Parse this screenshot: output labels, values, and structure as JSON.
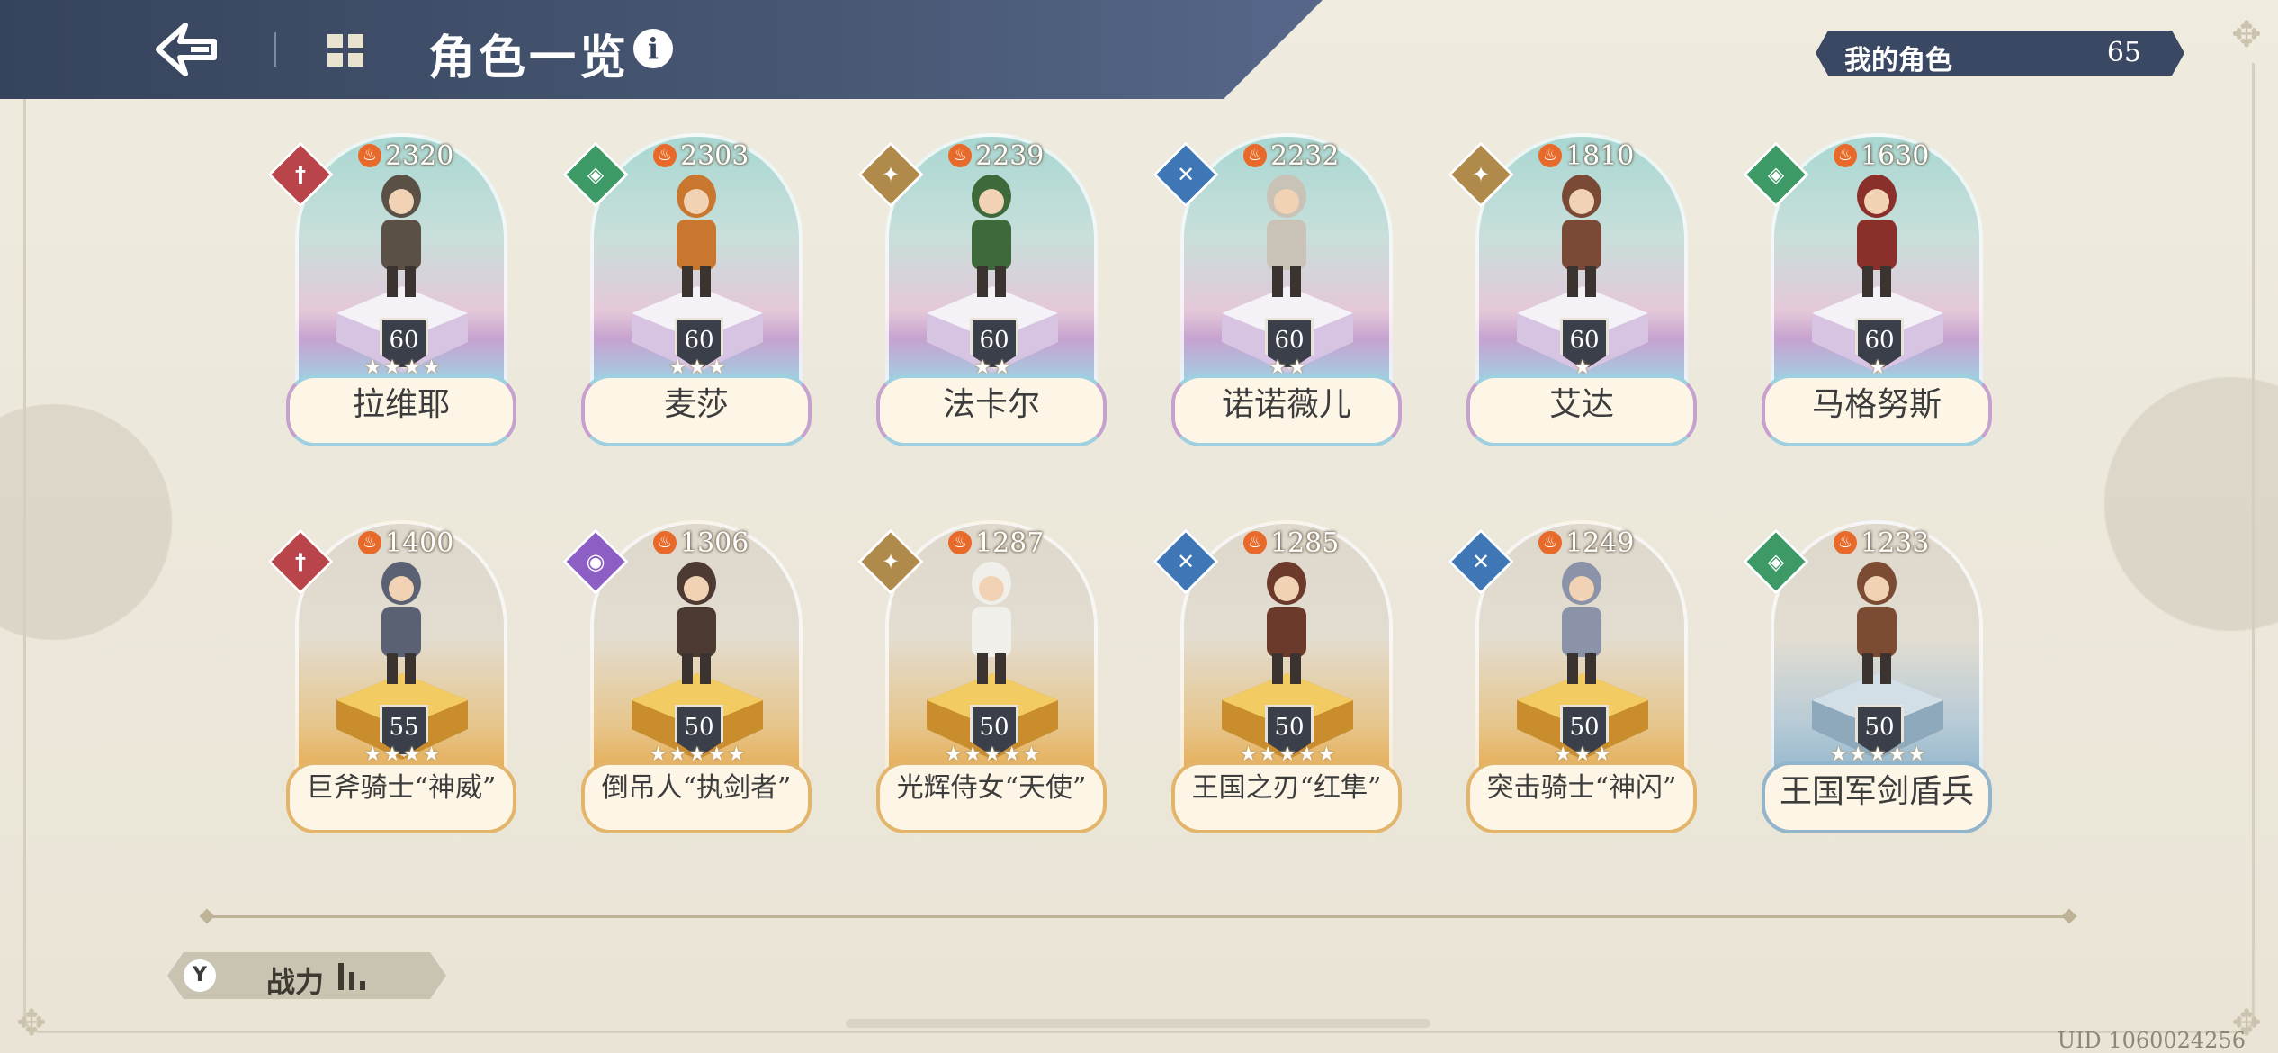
{
  "header": {
    "title": "角色一览",
    "info_glyph": "i"
  },
  "my_characters": {
    "label": "我的角色",
    "count": "65"
  },
  "colors": {
    "header_bg": "#3b4863",
    "class_red": "#b9454a",
    "class_green": "#3d9a66",
    "class_gold": "#b08a4a",
    "class_blue": "#3f77b6",
    "class_purple": "#8d5fc4"
  },
  "cards": [
    {
      "name": "拉维耶",
      "power": "2320",
      "level": "60",
      "stars": "★★★★",
      "class": "red",
      "style": "rainbow",
      "class_icon": "sword-icon"
    },
    {
      "name": "麦莎",
      "power": "2303",
      "level": "60",
      "stars": "★★★",
      "class": "green",
      "style": "rainbow",
      "class_icon": "shield-icon"
    },
    {
      "name": "法卡尔",
      "power": "2239",
      "level": "60",
      "stars": "★★",
      "class": "gold",
      "style": "rainbow",
      "class_icon": "compass-icon"
    },
    {
      "name": "诺诺薇儿",
      "power": "2232",
      "level": "60",
      "stars": "★★",
      "class": "blue",
      "style": "rainbow",
      "class_icon": "cross-icon"
    },
    {
      "name": "艾达",
      "power": "1810",
      "level": "60",
      "stars": "★",
      "class": "gold",
      "style": "rainbow",
      "class_icon": "compass-icon"
    },
    {
      "name": "马格努斯",
      "power": "1630",
      "level": "60",
      "stars": "★",
      "class": "green",
      "style": "rainbow",
      "class_icon": "shield-icon"
    },
    {
      "name": "巨斧骑士“神威”",
      "power": "1400",
      "level": "55",
      "stars": "★★★★",
      "class": "red",
      "style": "gold",
      "class_icon": "sword-icon"
    },
    {
      "name": "倒吊人“执剑者”",
      "power": "1306",
      "level": "50",
      "stars": "★★★★★",
      "class": "purple",
      "style": "gold",
      "class_icon": "eye-icon"
    },
    {
      "name": "光辉侍女“天使”",
      "power": "1287",
      "level": "50",
      "stars": "★★★★★",
      "class": "gold",
      "style": "gold",
      "class_icon": "compass-icon"
    },
    {
      "name": "王国之刃“红隼”",
      "power": "1285",
      "level": "50",
      "stars": "★★★★★",
      "class": "blue",
      "style": "gold",
      "class_icon": "cross-icon"
    },
    {
      "name": "突击骑士“神闪”",
      "power": "1249",
      "level": "50",
      "stars": "★★★",
      "class": "blue",
      "style": "gold",
      "class_icon": "cross-icon"
    },
    {
      "name": "王国军剑盾兵",
      "power": "1233",
      "level": "50",
      "stars": "★★★★★",
      "class": "green",
      "style": "blue",
      "class_icon": "shield-icon"
    }
  ],
  "filter": {
    "label": "战力",
    "icon_glyph": "Y"
  },
  "uid": "UID 1060024256"
}
